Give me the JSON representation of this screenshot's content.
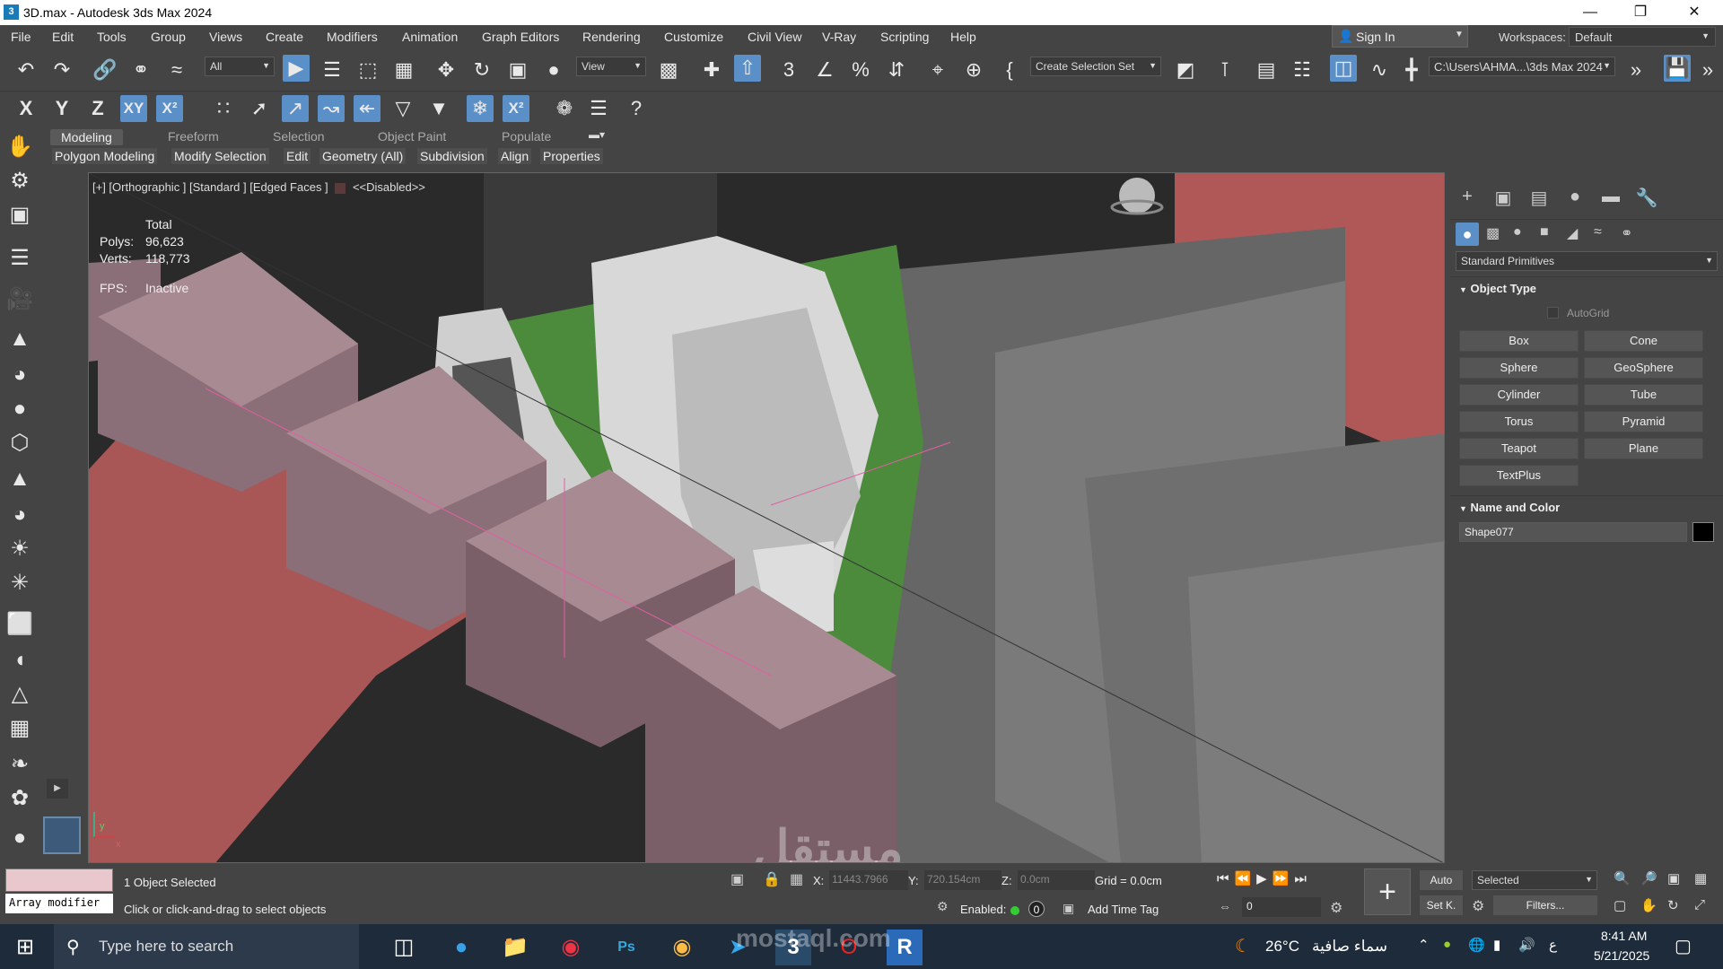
{
  "window": {
    "title": "3D.max - Autodesk 3ds Max 2024",
    "app_icon": "3"
  },
  "menu": [
    "File",
    "Edit",
    "Tools",
    "Group",
    "Views",
    "Create",
    "Modifiers",
    "Animation",
    "Graph Editors",
    "Rendering",
    "Customize",
    "Civil View",
    "V-Ray",
    "Scripting",
    "Help"
  ],
  "signin": {
    "label": "Sign In"
  },
  "workspaces": {
    "label": "Workspaces:",
    "value": "Default"
  },
  "toolbar": {
    "filter_value": "All",
    "refcoord_value": "View",
    "selection_set": "Create Selection Set",
    "project_path": "C:\\Users\\AHMA...\\3ds Max 2024"
  },
  "ribbon": {
    "tabs": [
      "Modeling",
      "Freeform",
      "Selection",
      "Object Paint",
      "Populate"
    ],
    "subtabs": [
      "Polygon Modeling",
      "Modify Selection",
      "Edit",
      "Geometry (All)",
      "Subdivision",
      "Align",
      "Properties"
    ]
  },
  "viewport": {
    "label": "[+] [Orthographic ] [Standard ] [Edged Faces ]",
    "disabled": "<<Disabled>>",
    "stats": {
      "total": "Total",
      "polys_label": "Polys:",
      "polys": "96,623",
      "verts_label": "Verts:",
      "verts": "118,773",
      "fps_label": "FPS:",
      "fps": "Inactive"
    },
    "axis_y": "y",
    "axis_x": "x"
  },
  "command_panel": {
    "category": "Standard Primitives",
    "object_type": "Object Type",
    "autogrid": "AutoGrid",
    "buttons": [
      "Box",
      "Cone",
      "Sphere",
      "GeoSphere",
      "Cylinder",
      "Tube",
      "Torus",
      "Pyramid",
      "Teapot",
      "Plane",
      "TextPlus"
    ],
    "name_color": "Name and Color",
    "object_name": "Shape077"
  },
  "status": {
    "modifier": "Array modifier",
    "selected": "1 Object Selected",
    "hint": "Click or click-and-drag to select objects",
    "x_label": "X:",
    "x_value": "11443.7966",
    "y_label": "Y:",
    "y_value": "720.154cm",
    "z_label": "Z:",
    "z_value": "0.0cm",
    "grid": "Grid = 0.0cm",
    "enabled": "Enabled:",
    "enabled_count": "0",
    "add_time_tag": "Add Time Tag",
    "auto": "Auto",
    "selected_dd": "Selected",
    "setk": "Set K.",
    "filters": "Filters...",
    "frame": "0"
  },
  "taskbar": {
    "search": "Type here to search",
    "weather_temp": "26°C",
    "weather_text": "سماء صافية",
    "lang": "ع",
    "time": "8:41 AM",
    "date": "5/21/2025"
  },
  "watermark": {
    "text": "مستقل",
    "sub": "mostaql.com"
  },
  "colors": {
    "accent": "#5b8fc7",
    "ground_red": "#b35a5a",
    "roof_green": "#4c8a3c",
    "block_mauve": "#8a6e78"
  }
}
